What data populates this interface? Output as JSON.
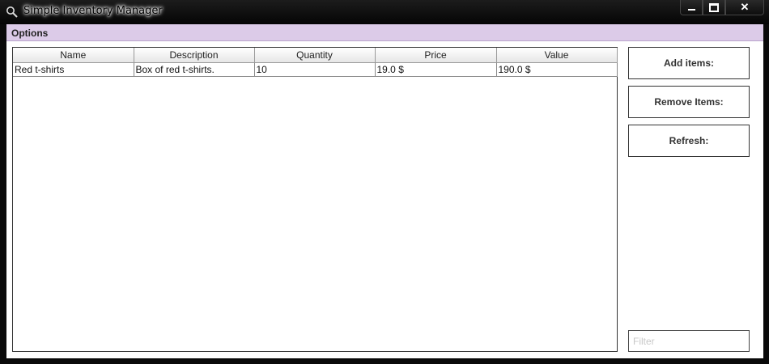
{
  "window": {
    "title": "Simple Inventory Manager"
  },
  "menu": {
    "options_label": "Options"
  },
  "table": {
    "columns": [
      "Name",
      "Description",
      "Quantity",
      "Price",
      "Value"
    ],
    "rows": [
      [
        "Red t-shirts",
        "Box of red t-shirts.",
        "10",
        "19.0 $",
        "190.0 $"
      ]
    ]
  },
  "buttons": {
    "add": "Add items:",
    "remove": "Remove Items:",
    "refresh": "Refresh:"
  },
  "filter": {
    "placeholder": "Filter",
    "value": ""
  }
}
